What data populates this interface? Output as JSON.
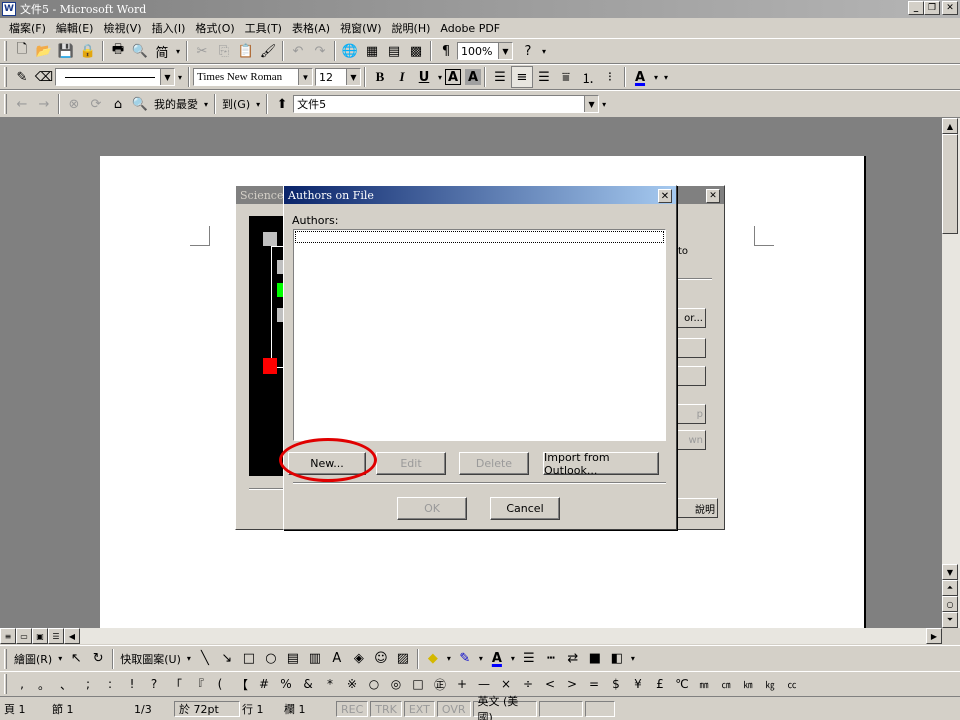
{
  "window": {
    "title": "文件5 - Microsoft Word",
    "minimize": "_",
    "restore": "❐",
    "close": "✕"
  },
  "menu": [
    "檔案(F)",
    "編輯(E)",
    "檢視(V)",
    "插入(I)",
    "格式(O)",
    "工具(T)",
    "表格(A)",
    "視窗(W)",
    "說明(H)",
    "Adobe PDF"
  ],
  "standard_toolbar": {
    "zoom": "100%",
    "convert_label": "简"
  },
  "drawing_toolbar": {
    "font_name": "Times New Roman",
    "font_size": "12"
  },
  "web_toolbar": {
    "favorites": "我的最愛",
    "goto": "到(G)",
    "address": "文件5"
  },
  "back_dialog": {
    "title": "Science M",
    "close": "✕",
    "partial_text": "to",
    "buttons": [
      "or...",
      "",
      "",
      "p",
      "wn"
    ],
    "help_label": "說明"
  },
  "dialog": {
    "title": "Authors on File",
    "close": "✕",
    "authors_label": "Authors:",
    "new_button": "New...",
    "edit_button": "Edit",
    "delete_button": "Delete",
    "import_button": "Import from Outlook...",
    "ok_button": "OK",
    "cancel_button": "Cancel"
  },
  "draw_bar": {
    "draw_label": "繪圖(R)",
    "autoshapes_label": "快取圖案(U)"
  },
  "symbols": [
    ",",
    "。",
    "、",
    ";",
    ":",
    "!",
    "?",
    "「",
    "『",
    "(",
    "【",
    "#",
    "%",
    "&",
    "*",
    "※",
    "○",
    "◎",
    "□",
    "㊣",
    "+",
    "—",
    "×",
    "÷",
    "<",
    ">",
    "=",
    "$",
    "¥",
    "£",
    "℃",
    "㎜",
    "㎝",
    "㎞",
    "㎏",
    "㏄"
  ],
  "status": {
    "page": "頁 1",
    "section": "節 1",
    "pages": "1/3",
    "at": "於 72pt",
    "line": "行 1",
    "col": "欄 1",
    "rec": "REC",
    "trk": "TRK",
    "ext": "EXT",
    "ovr": "OVR",
    "language": "英文 (美國)"
  },
  "colors": {
    "highlight": "#e00000",
    "active_title": "#0a246a"
  }
}
